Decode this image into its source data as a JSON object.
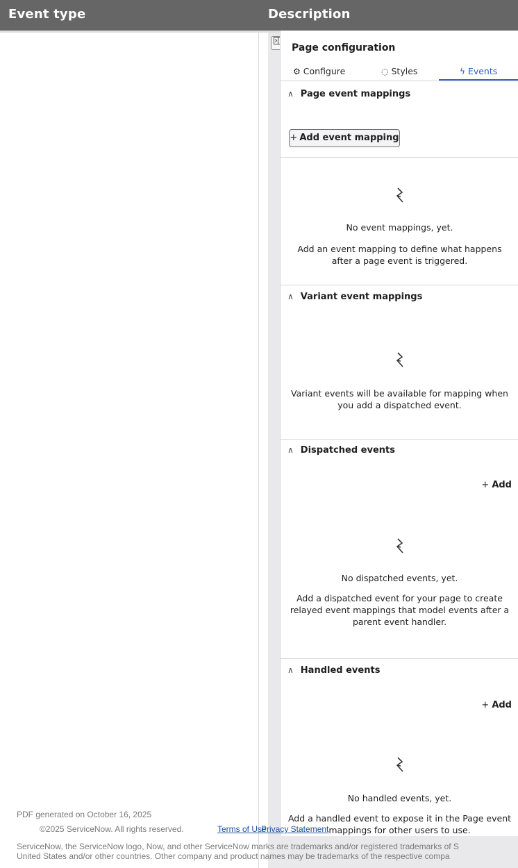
{
  "table": {
    "headers": [
      "Event type",
      "Description"
    ]
  },
  "panel": {
    "title": "Page configuration",
    "tabs": [
      {
        "label": "Configure",
        "icon": "gear-icon"
      },
      {
        "label": "Styles",
        "icon": "palette-icon"
      },
      {
        "label": "Events",
        "icon": "bolt-icon",
        "active": true
      }
    ],
    "accent_color": "#3b62c4",
    "sections": {
      "page_event_mappings": {
        "title": "Page event mappings",
        "add_button": "Add event mapping",
        "empty_title": "No event mappings, yet.",
        "empty_text": "Add an event mapping to define what happens after a page event is triggered."
      },
      "variant_event_mappings": {
        "title": "Variant event mappings",
        "empty_text": "Variant events will be available for mapping when you add a dispatched event."
      },
      "dispatched_events": {
        "title": "Dispatched events",
        "add_label": "Add",
        "empty_title": "No dispatched events, yet.",
        "empty_text": "Add a dispatched event for your page to create relayed event mappings that model events after a parent event handler."
      },
      "handled_events": {
        "title": "Handled events",
        "add_label": "Add",
        "empty_title": "No handled events, yet.",
        "empty_text": "Add a handled event to expose it in the Page event mappings for other users to use."
      }
    }
  },
  "footer": {
    "generated": "PDF generated on October 16, 2025",
    "copyright": "©2025 ServiceNow. All rights reserved.",
    "terms": "Terms of Use",
    "privacy": "Privacy Statement",
    "trademark_line1": "ServiceNow, the ServiceNow logo, Now, and other ServiceNow marks are trademarks and/or registered trademarks of S",
    "trademark_line2": "United States and/or other countries. Other company and product names may be trademarks of the respective compa"
  }
}
